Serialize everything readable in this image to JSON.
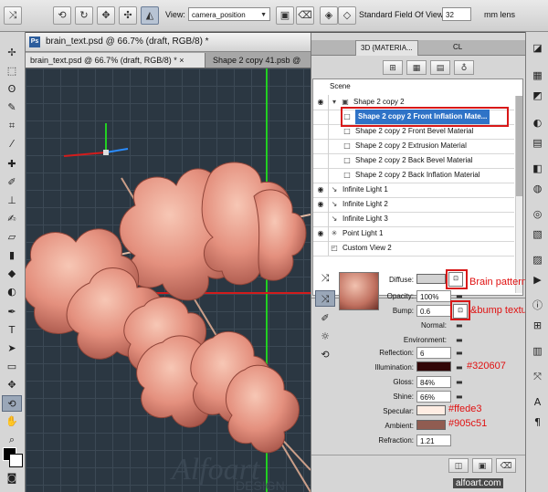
{
  "options_bar": {
    "view_label": "View:",
    "view_value": "camera_position",
    "fov_label": "Standard Field Of View:",
    "fov_value": "32",
    "fov_unit": "mm lens"
  },
  "document": {
    "window_title": "brain_text.psd @ 66.7% (draft, RGB/8) *",
    "tabs": [
      {
        "label": "brain_text.psd @ 66.7% (draft, RGB/8) *",
        "close": "×"
      },
      {
        "label": "Shape 2 copy 41.psb @ "
      }
    ],
    "watermark": "Alfoart",
    "watermark_sub": "DESIGN"
  },
  "panel": {
    "tab_label": "3D {MATERIA...",
    "tab_label_2": "CL",
    "scene_label": "Scene",
    "rows": [
      {
        "label": "Shape 2 copy 2",
        "eye": true,
        "icon": "mesh-icon",
        "selected": false
      },
      {
        "label": "Shape 2 copy 2 Front Inflation Mate...",
        "eye": false,
        "icon": "material-icon",
        "selected": true
      },
      {
        "label": "Shape 2 copy 2 Front Bevel Material",
        "eye": false,
        "icon": "material-icon",
        "selected": false
      },
      {
        "label": "Shape 2 copy 2 Extrusion Material",
        "eye": false,
        "icon": "material-icon",
        "selected": false
      },
      {
        "label": "Shape 2 copy 2 Back Bevel Material",
        "eye": false,
        "icon": "material-icon",
        "selected": false
      },
      {
        "label": "Shape 2 copy 2 Back Inflation Material",
        "eye": false,
        "icon": "material-icon",
        "selected": false
      },
      {
        "label": "Infinite Light 1",
        "eye": true,
        "icon": "infinite-light-icon",
        "selected": false
      },
      {
        "label": "Infinite Light 2",
        "eye": true,
        "icon": "infinite-light-icon",
        "selected": false
      },
      {
        "label": "Infinite Light 3",
        "eye": false,
        "icon": "infinite-light-icon",
        "selected": false
      },
      {
        "label": "Point Light 1",
        "eye": true,
        "icon": "point-light-icon",
        "selected": false
      },
      {
        "label": "Custom View 2",
        "eye": false,
        "icon": "camera-icon",
        "selected": false
      }
    ],
    "properties": {
      "diffuse_label": "Diffuse:",
      "opacity_label": "Opacity:",
      "opacity_value": "100%",
      "bump_label": "Bump:",
      "bump_value": "0.6",
      "normal_label": "Normal:",
      "environment_label": "Environment:",
      "reflection_label": "Reflection:",
      "reflection_value": "6",
      "illumination_label": "Illumination:",
      "gloss_label": "Gloss:",
      "gloss_value": "84%",
      "shine_label": "Shine:",
      "shine_value": "66%",
      "specular_label": "Specular:",
      "ambient_label": "Ambient:",
      "refraction_label": "Refraction:",
      "refraction_value": "1.21"
    },
    "colors": {
      "diffuse": "#d2d2d2",
      "illumination": "#320607",
      "specular": "#ffede3",
      "ambient": "#905c51",
      "annotation": "#e01010",
      "brain": "#e4907e"
    }
  },
  "annotations": {
    "diffuse_note": "Brain pattern",
    "bump_note": "&bump texture",
    "illumination_note": "#320607",
    "specular_note": "#ffede3",
    "ambient_note": "#905c51"
  },
  "credit": "alfoart.com"
}
